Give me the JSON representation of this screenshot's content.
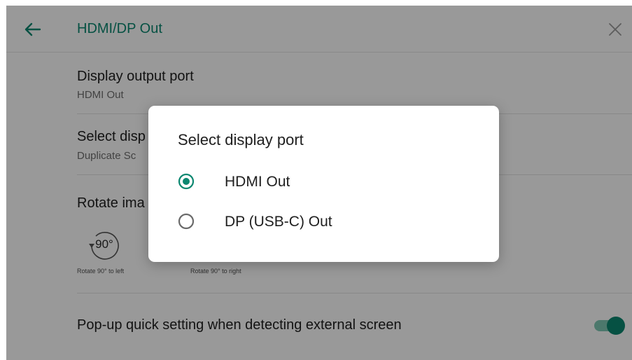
{
  "header": {
    "title": "HDMI/DP Out",
    "back_icon": "arrow-left-icon",
    "close_icon": "close-icon"
  },
  "settings": {
    "output_port": {
      "title": "Display output port",
      "value": "HDMI Out"
    },
    "select_display": {
      "title_visible": "Select disp",
      "value_visible": "Duplicate Sc"
    },
    "rotate": {
      "title_visible": "Rotate ima",
      "icon_label": "90°",
      "left_caption": "Rotate 90° to left",
      "right_caption": "Rotate 90° to right"
    },
    "popup": {
      "title": "Pop-up quick setting when detecting external screen",
      "enabled": true
    }
  },
  "dialog": {
    "title": "Select display port",
    "options": [
      {
        "label": "HDMI Out",
        "selected": true
      },
      {
        "label": "DP (USB-C) Out",
        "selected": false
      }
    ]
  },
  "colors": {
    "accent": "#0b8770",
    "toggle_track": "#7fc9b4",
    "scrim": "rgba(0,0,0,0.40)"
  }
}
